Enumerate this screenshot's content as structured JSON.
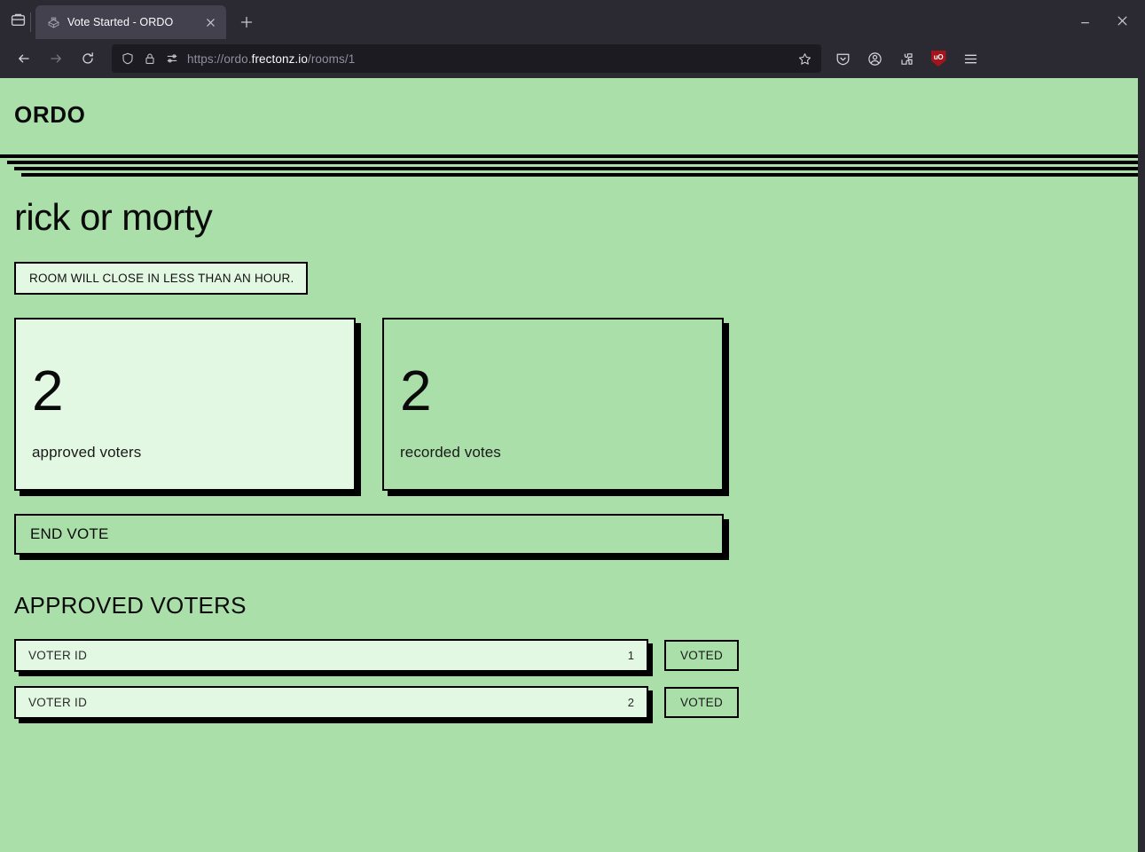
{
  "browser": {
    "tab": {
      "title": "Vote Started - ORDO",
      "favicon_name": "ballot-box-icon",
      "close_label": "×"
    },
    "new_tab_label": "+",
    "nav": {
      "back_label": "←",
      "forward_label": "→",
      "reload_label": "↻"
    },
    "url": {
      "prefix": "https://ordo.",
      "host": "frectonz.io",
      "path": "/rooms/1",
      "full": "https://ordo.frectonz.io/rooms/1"
    },
    "toolbar_icons": [
      "tab-list-icon",
      "shield-icon",
      "lock-icon",
      "reader-tools-icon",
      "bookmark-star-icon",
      "pocket-save-icon",
      "account-icon",
      "extensions-icon",
      "ublock-origin-icon",
      "app-menu-icon"
    ],
    "ublock_label": "uO",
    "window_controls": {
      "minimize": "—",
      "close": "×"
    }
  },
  "site": {
    "logo": "ORDO"
  },
  "room": {
    "title": "rick or morty",
    "notice": "Room will close in less than an hour."
  },
  "stats": [
    {
      "value": "2",
      "label": "approved voters",
      "variant": "mint"
    },
    {
      "value": "2",
      "label": "recorded votes",
      "variant": "plain"
    }
  ],
  "actions": {
    "end_vote_label": "End Vote"
  },
  "approved_voters": {
    "section_title": "Approved Voters",
    "field_label": "Voter ID",
    "rows": [
      {
        "id": "1",
        "status": "Voted"
      },
      {
        "id": "2",
        "status": "Voted"
      }
    ]
  },
  "colors": {
    "page_bg": "#aadfaa",
    "card_mint": "#e2f8e2",
    "ink": "#000000",
    "chrome_bg": "#2b2a33",
    "urlbar_bg": "#1c1b22",
    "ublock_red": "#a4141a"
  }
}
